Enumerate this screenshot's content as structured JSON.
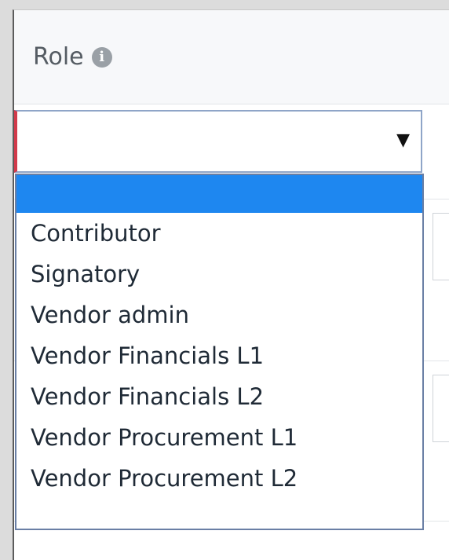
{
  "field": {
    "label": "Role",
    "info_icon": "info-icon",
    "selected_value": "",
    "caret": "▼"
  },
  "dropdown": {
    "highlighted_option": "",
    "options": [
      "Contributor",
      "Signatory",
      "Vendor admin",
      "Vendor Financials L1",
      "Vendor Financials L2",
      "Vendor Procurement L1",
      "Vendor Procurement L2"
    ]
  },
  "colors": {
    "highlight": "#1e87f0",
    "invalid_marker": "#d23a4b",
    "focus_border": "#8fa5c8",
    "label_text": "#555c63"
  }
}
